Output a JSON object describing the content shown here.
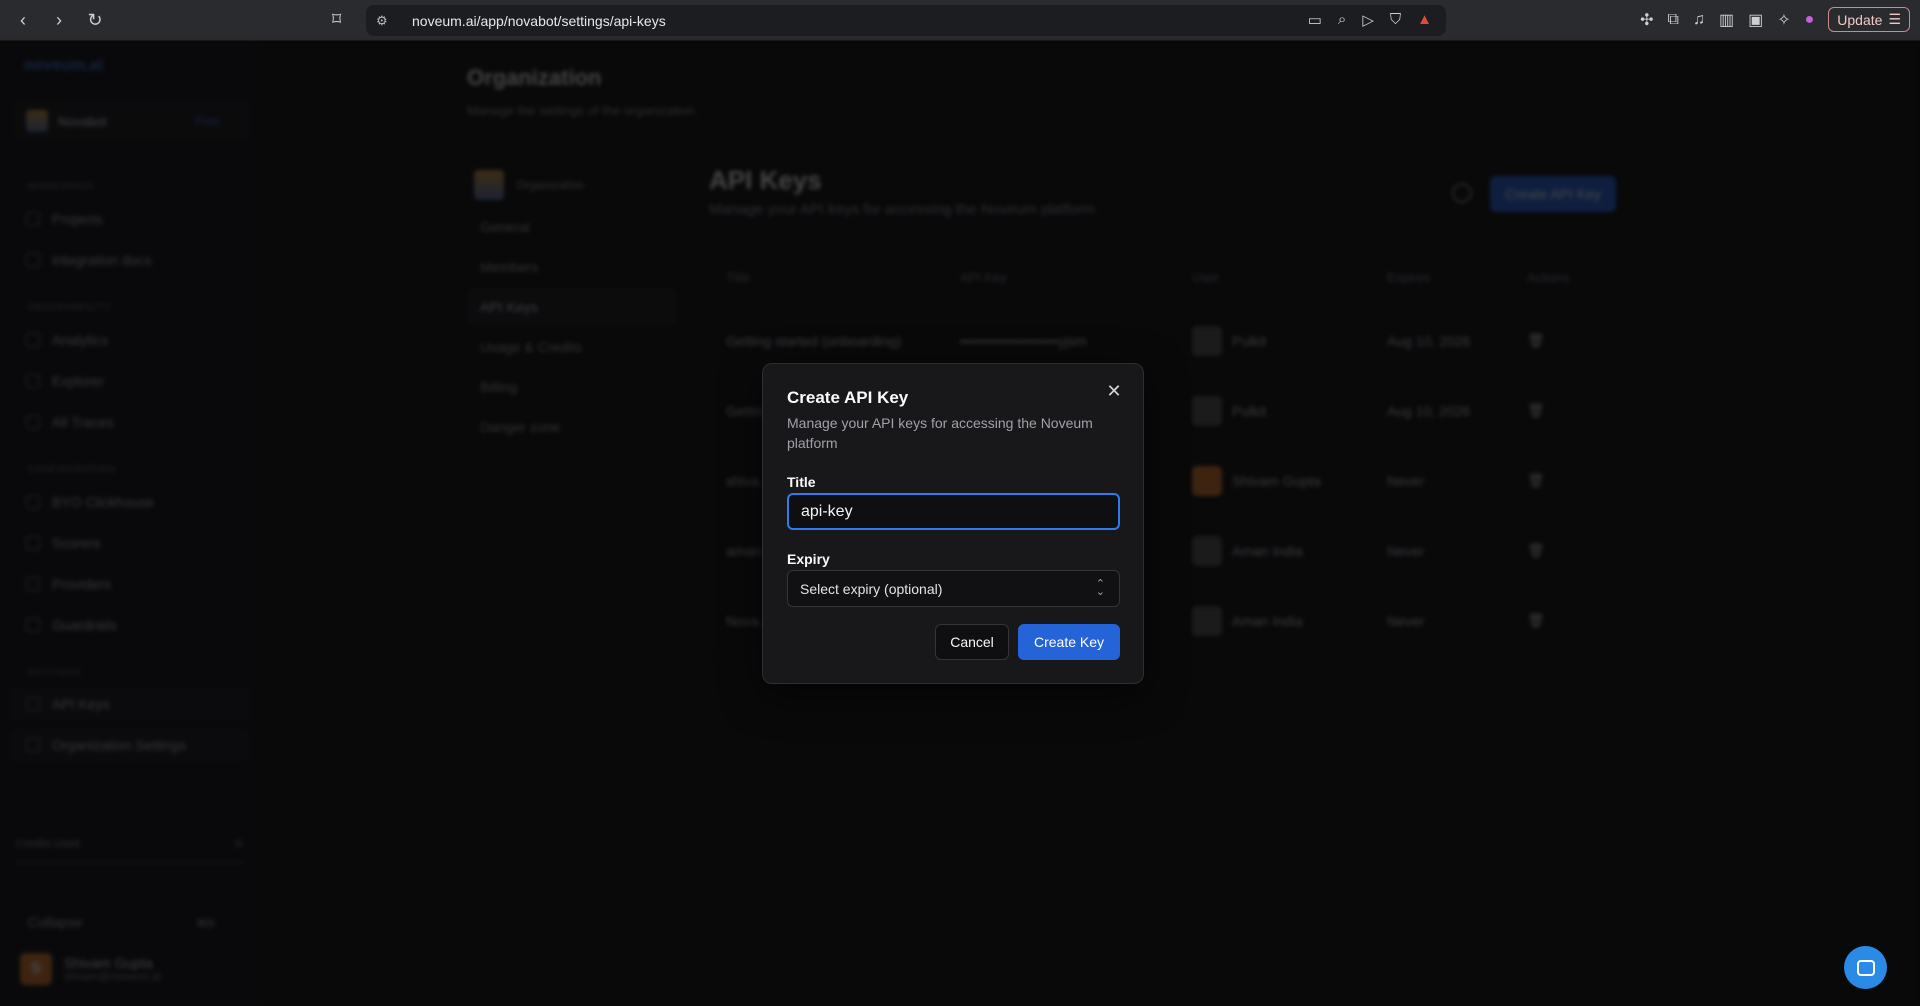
{
  "browser": {
    "url": "noveum.ai/app/novabot/settings/api-keys",
    "update_label": "Update"
  },
  "sidebar": {
    "logo": "noveum.ai",
    "workspace_name": "Novabot",
    "workspace_tag": "Free",
    "sections": [
      {
        "title": "WORKSPACE",
        "items": [
          "Projects",
          "Integration docs"
        ]
      },
      {
        "title": "OBSERVABILITY",
        "items": [
          "Analytics",
          "Explorer",
          "All Traces"
        ]
      },
      {
        "title": "CONFIGURATION",
        "items": [
          "BYO Clickhouse",
          "Scorers",
          "Providers",
          "Guardrails"
        ]
      },
      {
        "title": "SETTINGS",
        "items": [
          "API Keys",
          "Organization Settings"
        ]
      }
    ],
    "credits_label": "Credits Used",
    "credits_value": "0",
    "collapse_label": "Collapse",
    "collapse_shortcut": "⌘B",
    "user_name": "Shivam Gupta",
    "user_email": "shivam@noveum.ai",
    "user_initial": "S"
  },
  "org": {
    "title": "Organization",
    "subtitle": "Manage the settings of the organization.",
    "subnav_head": "Organization",
    "subnav": [
      "General",
      "Members",
      "API Keys",
      "Usage & Credits",
      "Billing",
      "Danger zone"
    ]
  },
  "keys_page": {
    "title": "API Keys",
    "subtitle": "Manage your API keys for accessing the Noveum platform",
    "create_button": "Create API Key",
    "columns": [
      "Title",
      "API Key",
      "User",
      "Expires",
      "Actions"
    ],
    "rows": [
      {
        "title": "Getting started (onboarding)",
        "key": "••••••••••••••••••••yjsm",
        "user": "Pulkit",
        "expires": "Aug 10, 2026"
      },
      {
        "title": "Getting...",
        "key": "",
        "user": "Pulkit",
        "expires": "Aug 10, 2026"
      },
      {
        "title": "shiva...",
        "key": "",
        "user": "Shivam Gupta",
        "expires": "Never"
      },
      {
        "title": "aman...",
        "key": "",
        "user": "Aman India",
        "expires": "Never"
      },
      {
        "title": "Nova...",
        "key": "",
        "user": "Aman India",
        "expires": "Never"
      }
    ]
  },
  "modal": {
    "title": "Create API Key",
    "description": "Manage your API keys for accessing the Noveum platform",
    "title_label": "Title",
    "title_value": "api-key",
    "expiry_label": "Expiry",
    "expiry_placeholder": "Select expiry (optional)",
    "cancel_label": "Cancel",
    "create_label": "Create Key"
  }
}
